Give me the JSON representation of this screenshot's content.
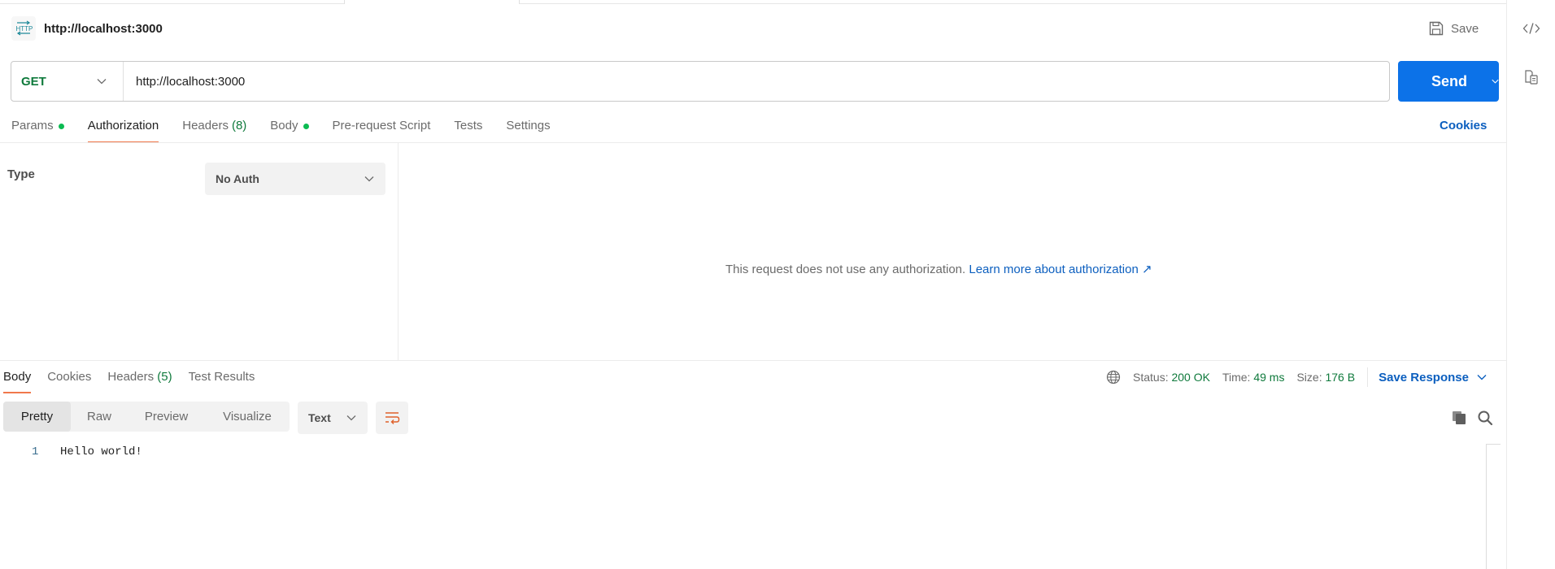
{
  "request": {
    "title": "http://localhost:3000",
    "icon": "http-icon",
    "save_label": "Save",
    "method": "GET",
    "url": "http://localhost:3000",
    "send_label": "Send"
  },
  "request_tabs": [
    {
      "label": "Params",
      "dot": true
    },
    {
      "label": "Authorization",
      "active": true
    },
    {
      "label": "Headers",
      "count": "(8)"
    },
    {
      "label": "Body",
      "dot": true
    },
    {
      "label": "Pre-request Script"
    },
    {
      "label": "Tests"
    },
    {
      "label": "Settings"
    }
  ],
  "cookies_label": "Cookies",
  "auth": {
    "type_label": "Type",
    "selected_type": "No Auth",
    "message": "This request does not use any authorization.",
    "link_label": "Learn more about authorization ↗"
  },
  "response": {
    "tabs": [
      {
        "label": "Body",
        "active": true
      },
      {
        "label": "Cookies"
      },
      {
        "label": "Headers",
        "count": "(5)"
      },
      {
        "label": "Test Results"
      }
    ],
    "status_label": "Status:",
    "status_value": "200 OK",
    "time_label": "Time:",
    "time_value": "49 ms",
    "size_label": "Size:",
    "size_value": "176 B",
    "save_response_label": "Save Response",
    "view_modes": [
      "Pretty",
      "Raw",
      "Preview",
      "Visualize"
    ],
    "active_view": "Pretty",
    "format": "Text",
    "lines": [
      {
        "no": "1",
        "text": "Hello world!"
      }
    ]
  },
  "colors": {
    "send": "#0c72e8",
    "accent_underline": "#f0784b",
    "status_ok": "#0f7a3c",
    "link": "#0c5fbf"
  }
}
